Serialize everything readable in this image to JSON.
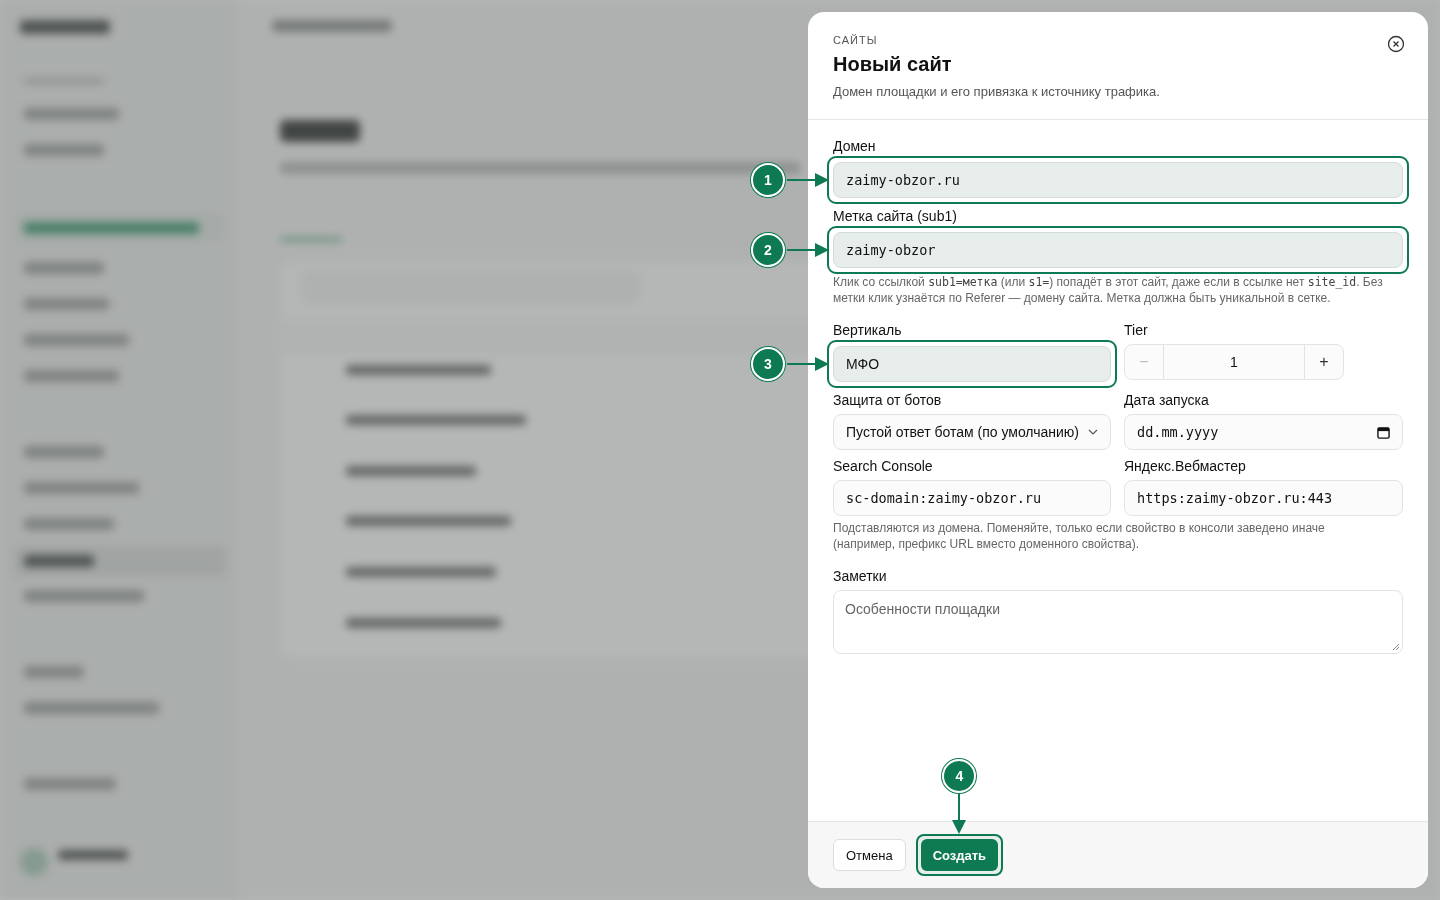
{
  "modal": {
    "eyebrow": "САЙТЫ",
    "title": "Новый сайт",
    "subtitle": "Домен площадки и его привязка к источнику трафика.",
    "rows": [
      [
        {
          "kind": "text",
          "label": "Домен",
          "value": "zaimy-obzor.ru",
          "mono": true,
          "callout": "1"
        }
      ],
      [
        {
          "kind": "text",
          "label": "Метка сайта (sub1)",
          "value": "zaimy-obzor",
          "mono": true,
          "callout": "2"
        }
      ],
      [
        {
          "kind": "help",
          "parts": [
            {
              "text": "Клик со ссылкой "
            },
            {
              "text": "sub1=метка",
              "code": true
            },
            {
              "text": " (или "
            },
            {
              "text": "s1=",
              "code": true
            },
            {
              "text": ") попадёт в этот сайт, даже если в ссылке нет "
            },
            {
              "text": "site_id",
              "code": true
            },
            {
              "text": ". Без метки клик узнаётся по Referer — домену сайта. Метка должна быть уникальной в сетке."
            }
          ]
        }
      ],
      [
        {
          "kind": "text",
          "label": "Вертикаль",
          "value": "МФО",
          "mono": false,
          "callout": "3"
        },
        {
          "kind": "stepper",
          "label": "Tier",
          "value": "1",
          "minus": "−",
          "plus": "+",
          "minus_disabled": true
        }
      ],
      [
        {
          "kind": "select",
          "label": "Защита от ботов",
          "value": "Пустой ответ ботам (по умолчанию)"
        },
        {
          "kind": "date",
          "label": "Дата запуска",
          "value": "dd.mm.yyyy"
        }
      ],
      [
        {
          "kind": "text",
          "label": "Search Console",
          "value": "sc-domain:zaimy-obzor.ru",
          "mono": true
        },
        {
          "kind": "text",
          "label": "Яндекс.Вебмастер",
          "value": "https:zaimy-obzor.ru:443",
          "mono": true
        }
      ],
      [
        {
          "kind": "help",
          "parts": [
            {
              "text": "Подставляются из домена. Поменяйте, только если свойство в консоли заведено иначе (например, префикс URL вместо доменного свойства)."
            }
          ]
        }
      ],
      [
        {
          "kind": "textarea",
          "label": "Заметки",
          "placeholder": "Особенности площадки"
        }
      ]
    ],
    "buttons": [
      {
        "label": "Отмена",
        "kind": "secondary"
      },
      {
        "label": "Создать",
        "kind": "primary",
        "callout": "4"
      }
    ]
  }
}
